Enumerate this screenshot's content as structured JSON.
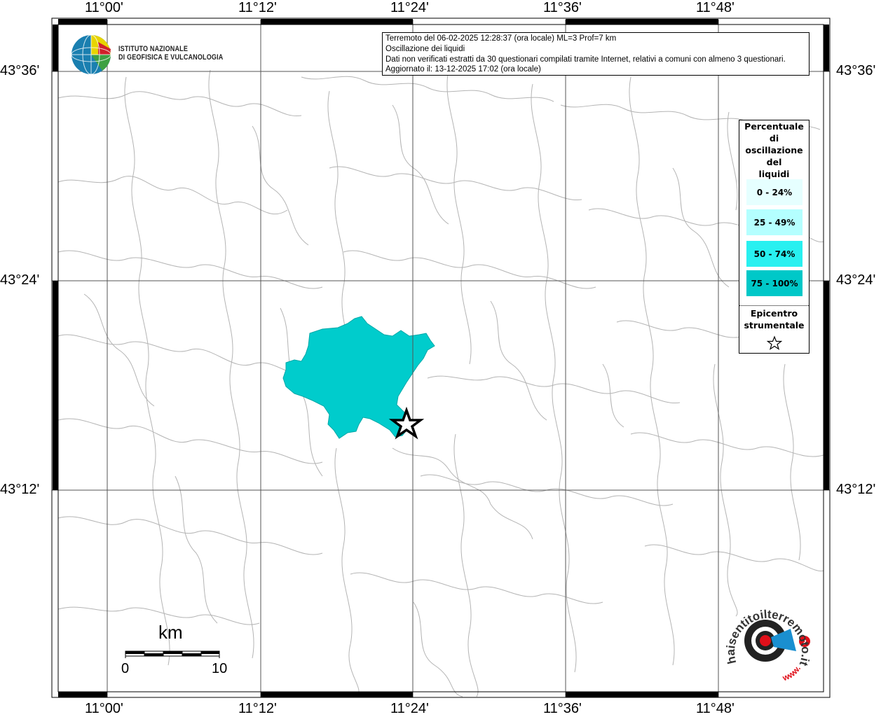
{
  "map": {
    "title_lines": [
      "Terremoto del 06-02-2025 12:28:37 (ora locale) ML=3 Prof=7 km",
      "Oscillazione dei liquidi",
      "Dati non verificati estratti da 30 questionari compilati tramite Internet, relativi a comuni con almeno 3 questionari.",
      "Aggiornato il: 13-12-2025 17:02 (ora locale)"
    ],
    "longitude_ticks": [
      "11°00'",
      "11°12'",
      "11°24'",
      "11°36'",
      "11°48'"
    ],
    "latitude_ticks": [
      "43°36'",
      "43°24'",
      "43°12'"
    ],
    "agency_logo": {
      "name_line1": "ISTITUTO NAZIONALE",
      "name_line2": "DI GEOFISICA E VULCANOLOGIA",
      "icon": "globe-logo-icon"
    },
    "legend": {
      "title_lines": [
        "Percentuale",
        "di",
        "oscillazione",
        "del",
        "liquidi"
      ],
      "classes": [
        {
          "label": "0 - 24%",
          "color": "#e6ffff"
        },
        {
          "label": "25 - 49%",
          "color": "#b4ffff"
        },
        {
          "label": "50 - 74%",
          "color": "#28f0f0"
        },
        {
          "label": "75 - 100%",
          "color": "#00c8c8"
        }
      ],
      "epicenter_line1": "Epicentro",
      "epicenter_line2": "strumentale",
      "epicenter_icon": "star-icon"
    },
    "scale_bar": {
      "unit": "km",
      "start": "0",
      "end": "10"
    },
    "highlighted_area_color": "#00cccc",
    "site_logo": {
      "text": "haisentitoilterremoto.it",
      "prefix": "www.",
      "icon": "target-megaphone-icon"
    }
  }
}
